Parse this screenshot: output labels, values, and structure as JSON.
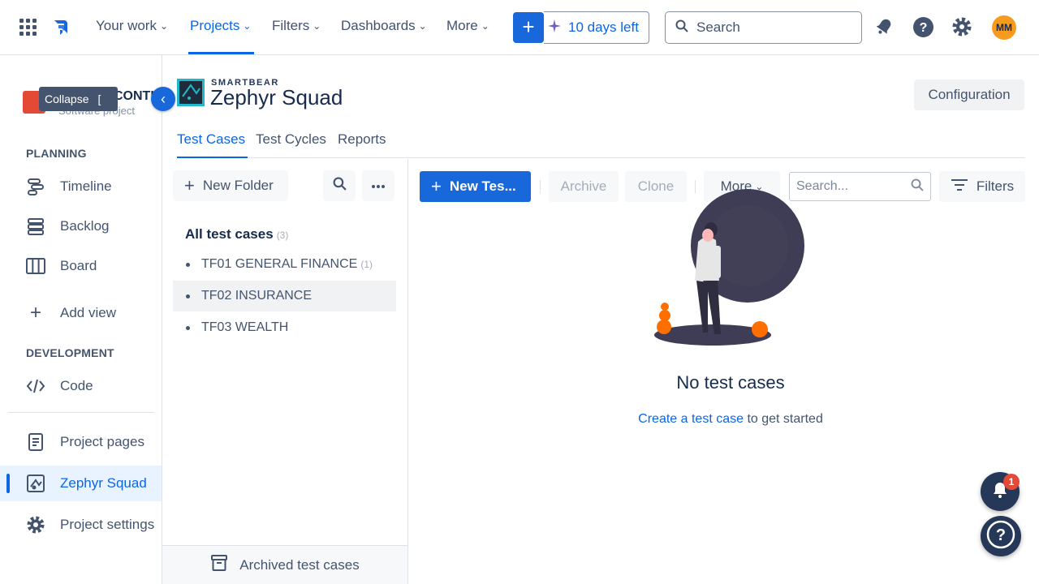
{
  "topnav": {
    "items": [
      "Your work",
      "Projects",
      "Filters",
      "Dashboards",
      "More"
    ],
    "trial_label": "10 days left",
    "search_placeholder": "Search",
    "avatar_initials": "MM",
    "accent_color": "#0c66e4"
  },
  "sidebar": {
    "project_name_partial": "CONTI",
    "project_type": "Software project",
    "tooltip": {
      "label": "Collapse",
      "shortcut": "["
    },
    "planning_heading": "PLANNING",
    "planning_items": [
      {
        "label": "Timeline",
        "icon": "timeline-icon"
      },
      {
        "label": "Backlog",
        "icon": "backlog-icon"
      },
      {
        "label": "Board",
        "icon": "board-icon"
      },
      {
        "label": "Add view",
        "icon": "plus-icon"
      }
    ],
    "development_heading": "DEVELOPMENT",
    "development_items": [
      {
        "label": "Code",
        "icon": "code-icon"
      }
    ],
    "bottom_items": [
      {
        "label": "Project pages",
        "icon": "page-icon"
      },
      {
        "label": "Zephyr Squad",
        "icon": "zephyr-icon",
        "selected": true
      },
      {
        "label": "Project settings",
        "icon": "gear-icon"
      }
    ]
  },
  "header": {
    "brand_small": "SMARTBEAR",
    "brand_big": "Zephyr Squad",
    "config_label": "Configuration",
    "tabs": [
      "Test Cases",
      "Test Cycles",
      "Reports"
    ],
    "active_tab": "Test Cases"
  },
  "folders": {
    "new_folder_label": "New Folder",
    "all_label": "All test cases",
    "all_count": "(3)",
    "items": [
      {
        "name": "TF01 GENERAL FINANCE",
        "count": "(1)"
      },
      {
        "name": "TF02 INSURANCE",
        "count": ""
      },
      {
        "name": "TF03 WEALTH",
        "count": ""
      }
    ],
    "archived_label": "Archived test cases"
  },
  "toolbar": {
    "new_test_label": "New Tes...",
    "archive_label": "Archive",
    "clone_label": "Clone",
    "more_label": "More",
    "search_placeholder": "Search...",
    "filters_label": "Filters"
  },
  "empty_state": {
    "title": "No test cases",
    "link_text": "Create a test case",
    "suffix": " to get started"
  },
  "notifications": {
    "badge": "1"
  }
}
